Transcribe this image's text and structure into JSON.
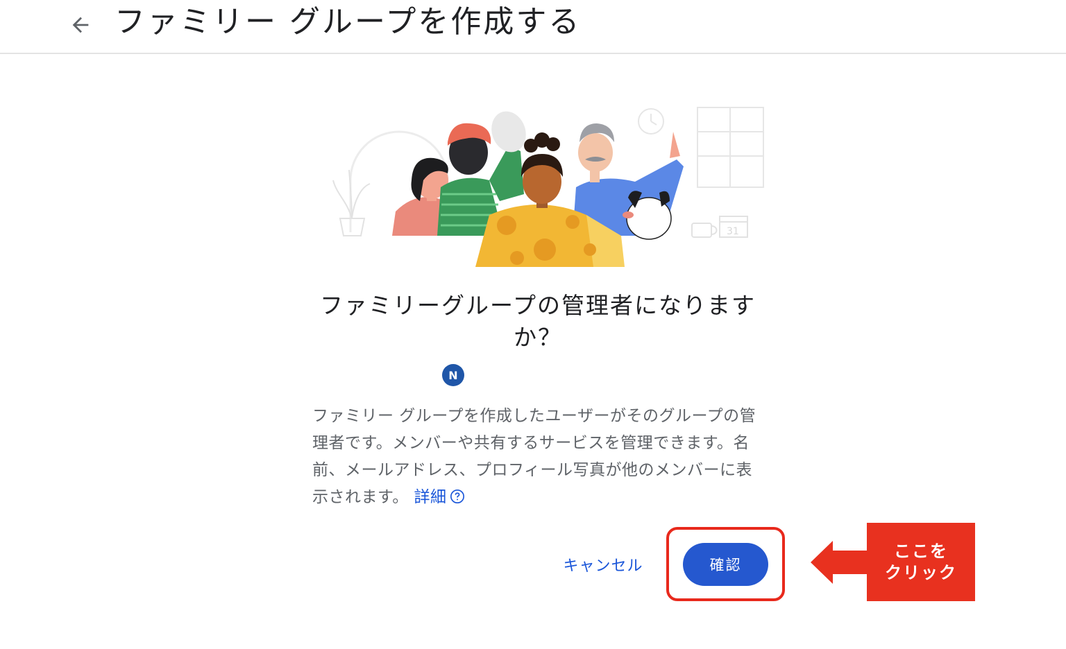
{
  "header": {
    "title": "ファミリー グループを作成する"
  },
  "illustration": {
    "calendar_day": "31"
  },
  "dialog": {
    "question": "ファミリーグループの管理者になりますか？",
    "avatar_initial": "N",
    "description": "ファミリー グループを作成したユーザーがそのグループの管理者です。メンバーや共有するサービスを管理できます。名前、メールアドレス、プロフィール写真が他のメンバーに表示されます。",
    "learn_more_label": "詳細",
    "cancel_label": "キャンセル",
    "confirm_label": "確認"
  },
  "annotation": {
    "line1": "ここを",
    "line2": "クリック",
    "color": "#e8311f"
  },
  "colors": {
    "primary": "#2558cf",
    "link": "#1a56d9",
    "avatar": "#1f56a8"
  }
}
